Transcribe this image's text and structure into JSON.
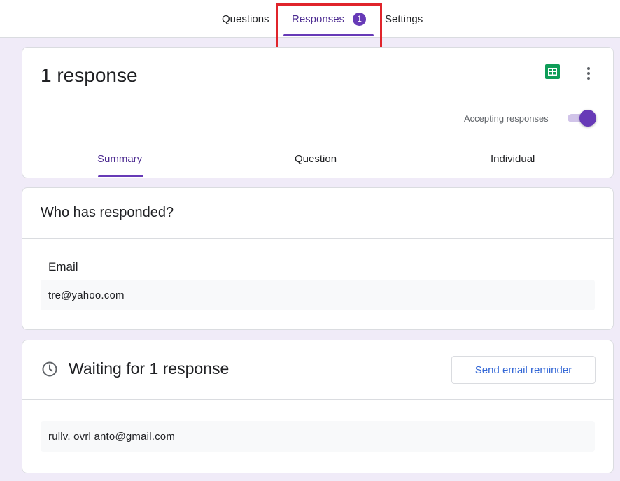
{
  "top_tabs": {
    "questions": "Questions",
    "responses": "Responses",
    "responses_count": "1",
    "settings": "Settings"
  },
  "summary_card": {
    "title": "1 response",
    "accepting_label": "Accepting responses",
    "accepting_enabled": true,
    "sheets_icon": "google-sheets-icon",
    "more_icon": "more-vert-icon",
    "subtabs": {
      "summary": "Summary",
      "question": "Question",
      "individual": "Individual"
    }
  },
  "responded_card": {
    "title": "Who has responded?",
    "column_label": "Email",
    "emails": [
      "tre@yahoo.com"
    ]
  },
  "waiting_card": {
    "icon": "clock-icon",
    "title": "Waiting for 1 response",
    "reminder_button": "Send email reminder",
    "emails": [
      "rullv.  ovrl anto@gmail.com"
    ]
  },
  "colors": {
    "accent": "#673ab7",
    "background": "#f0ebf8",
    "highlight": "#e0242b",
    "link_blue": "#3367d6",
    "sheets_green": "#0f9d58"
  }
}
